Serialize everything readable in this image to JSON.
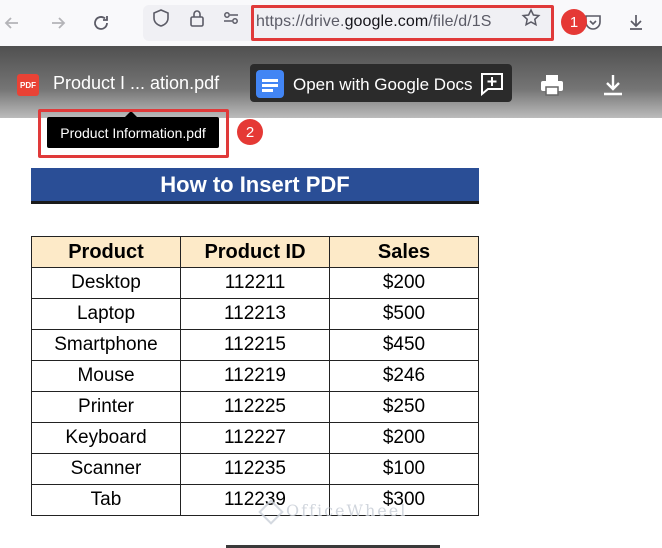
{
  "browser": {
    "url_prefix": "https://drive.",
    "url_host": "google.com",
    "url_suffix": "/file/d/1S",
    "callout_1": "1",
    "callout_2": "2"
  },
  "viewer": {
    "pdf_chip": "PDF",
    "file_title": "Product I ... ation.pdf",
    "open_with_label": "Open with Google Docs",
    "tooltip": "Product Information.pdf"
  },
  "document": {
    "title": "How to Insert PDF",
    "headers": [
      "Product",
      "Product ID",
      "Sales"
    ],
    "rows": [
      [
        "Desktop",
        "112211",
        "$200"
      ],
      [
        "Laptop",
        "112213",
        "$500"
      ],
      [
        "Smartphone",
        "112215",
        "$450"
      ],
      [
        "Mouse",
        "112219",
        "$246"
      ],
      [
        "Printer",
        "112225",
        "$250"
      ],
      [
        "Keyboard",
        "112227",
        "$200"
      ],
      [
        "Scanner",
        "112235",
        "$100"
      ],
      [
        "Tab",
        "112239",
        "$300"
      ]
    ],
    "watermark": "OfficeWheel"
  },
  "colors": {
    "callout_red": "#e03a3a",
    "title_bar": "#2a4e96",
    "header_fill": "#fdeac8"
  }
}
